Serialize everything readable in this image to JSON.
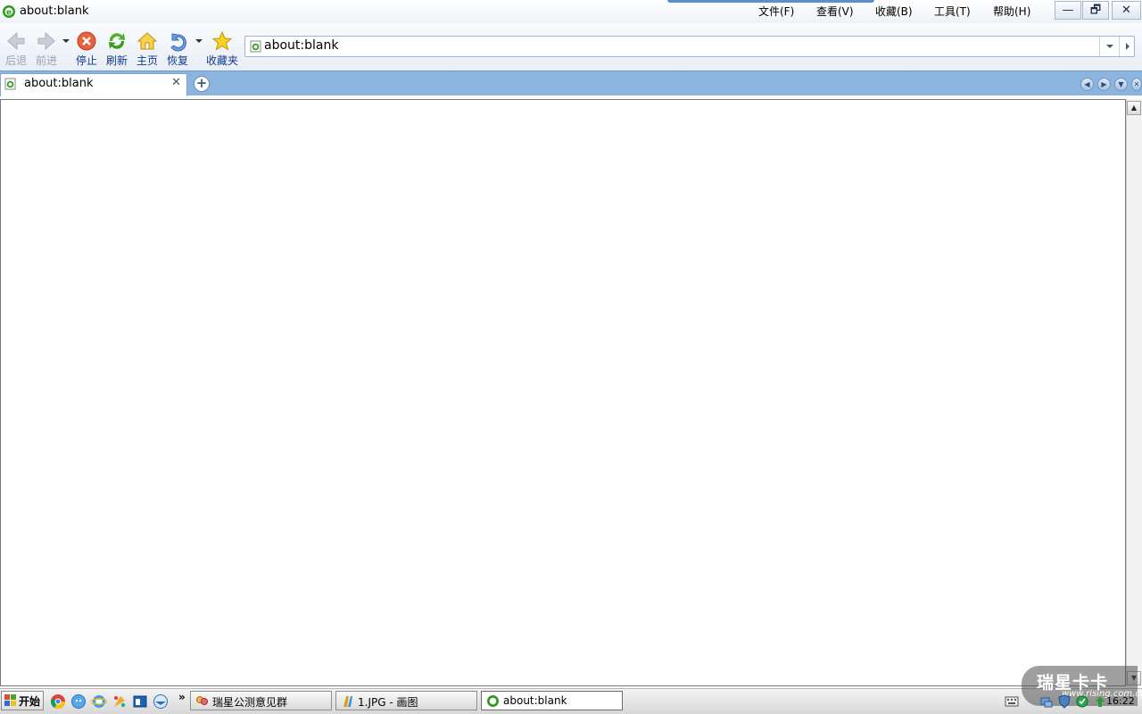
{
  "window": {
    "title": "about:blank",
    "menu": [
      {
        "label": "文件(F)"
      },
      {
        "label": "查看(V)"
      },
      {
        "label": "收藏(B)"
      },
      {
        "label": "工具(T)"
      },
      {
        "label": "帮助(H)"
      }
    ],
    "controls": {
      "minimize": "—",
      "restore": "🗗",
      "close": "✕"
    }
  },
  "toolbar": {
    "back": "后退",
    "forward": "前进",
    "stop": "停止",
    "refresh": "刷新",
    "home": "主页",
    "restore": "恢复",
    "favorites": "收藏夹"
  },
  "address": {
    "value": "about:blank"
  },
  "tabs": [
    {
      "label": "about:blank",
      "close": "✕",
      "active": true
    }
  ],
  "new_tab": "+",
  "taskbar": {
    "start_label": "开始",
    "quicklaunch_more": "»",
    "tasks": [
      {
        "label": "瑞星公测意见群",
        "active": false
      },
      {
        "label": "1.JPG - 画图",
        "active": false
      },
      {
        "label": "about:blank",
        "active": true
      }
    ],
    "clock": "16:22"
  },
  "watermark": {
    "text": "瑞星卡卡",
    "url": "www.rising.com.cn"
  },
  "colors": {
    "tabbar": "#8bb4df",
    "link_label": "#0e3c8a",
    "taskbar": "#d8d8d8"
  }
}
